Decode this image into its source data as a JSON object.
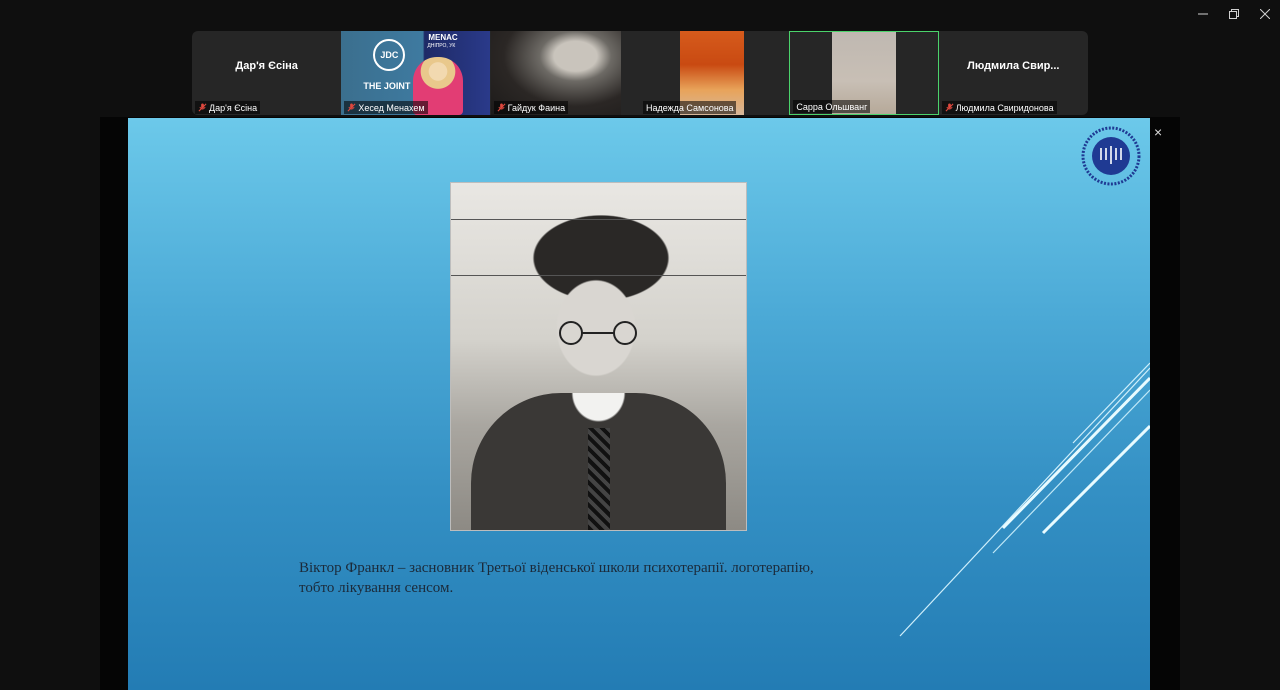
{
  "window": {
    "controls": {
      "minimize_icon": "minimize-icon",
      "restore_icon": "restore-icon",
      "close_icon": "close-icon"
    }
  },
  "participants": [
    {
      "display_name": "Дар'я Єсіна",
      "label": "Дар'я Єсіна",
      "muted": true,
      "video": false
    },
    {
      "display_name": "",
      "label": "Хесед Менахем",
      "muted": true,
      "video": true,
      "video_text": [
        "JDC",
        "THE JOINT",
        "MENAC",
        "ДНІПРО, УК"
      ]
    },
    {
      "display_name": "",
      "label": "Гайдук Фаина",
      "muted": true,
      "video": true
    },
    {
      "display_name": "",
      "label": "Надежда Самсонова",
      "muted": false,
      "video": true
    },
    {
      "display_name": "",
      "label": "Сарра Ольшванг",
      "muted": false,
      "video": true,
      "active_speaker": true
    },
    {
      "display_name": "Людмила  Свир...",
      "label": "Людмила Свиридонова",
      "muted": true,
      "video": false
    }
  ],
  "slide": {
    "caption_line1": "Віктор Франкл – засновник  Третьої віденської школи психотерапії.  логотерапію,",
    "caption_line2": "тобто лікування  сенсом.",
    "close_label": "×"
  },
  "colors": {
    "slide_top": "#6cc9ea",
    "slide_bottom": "#237cb4",
    "active_speaker_border": "#4bd36b",
    "mute_icon": "#e0483e"
  }
}
